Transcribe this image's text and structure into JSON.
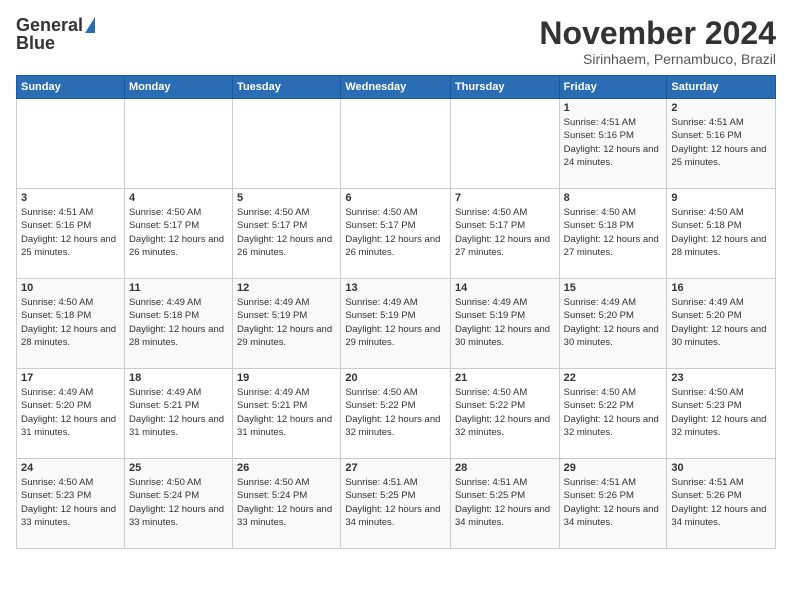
{
  "header": {
    "logo_line1": "General",
    "logo_line2": "Blue",
    "title": "November 2024",
    "subtitle": "Sirinhaem, Pernambuco, Brazil"
  },
  "calendar": {
    "days_of_week": [
      "Sunday",
      "Monday",
      "Tuesday",
      "Wednesday",
      "Thursday",
      "Friday",
      "Saturday"
    ],
    "weeks": [
      [
        {
          "day": "",
          "info": ""
        },
        {
          "day": "",
          "info": ""
        },
        {
          "day": "",
          "info": ""
        },
        {
          "day": "",
          "info": ""
        },
        {
          "day": "",
          "info": ""
        },
        {
          "day": "1",
          "info": "Sunrise: 4:51 AM\nSunset: 5:16 PM\nDaylight: 12 hours and 24 minutes."
        },
        {
          "day": "2",
          "info": "Sunrise: 4:51 AM\nSunset: 5:16 PM\nDaylight: 12 hours and 25 minutes."
        }
      ],
      [
        {
          "day": "3",
          "info": "Sunrise: 4:51 AM\nSunset: 5:16 PM\nDaylight: 12 hours and 25 minutes."
        },
        {
          "day": "4",
          "info": "Sunrise: 4:50 AM\nSunset: 5:17 PM\nDaylight: 12 hours and 26 minutes."
        },
        {
          "day": "5",
          "info": "Sunrise: 4:50 AM\nSunset: 5:17 PM\nDaylight: 12 hours and 26 minutes."
        },
        {
          "day": "6",
          "info": "Sunrise: 4:50 AM\nSunset: 5:17 PM\nDaylight: 12 hours and 26 minutes."
        },
        {
          "day": "7",
          "info": "Sunrise: 4:50 AM\nSunset: 5:17 PM\nDaylight: 12 hours and 27 minutes."
        },
        {
          "day": "8",
          "info": "Sunrise: 4:50 AM\nSunset: 5:18 PM\nDaylight: 12 hours and 27 minutes."
        },
        {
          "day": "9",
          "info": "Sunrise: 4:50 AM\nSunset: 5:18 PM\nDaylight: 12 hours and 28 minutes."
        }
      ],
      [
        {
          "day": "10",
          "info": "Sunrise: 4:50 AM\nSunset: 5:18 PM\nDaylight: 12 hours and 28 minutes."
        },
        {
          "day": "11",
          "info": "Sunrise: 4:49 AM\nSunset: 5:18 PM\nDaylight: 12 hours and 28 minutes."
        },
        {
          "day": "12",
          "info": "Sunrise: 4:49 AM\nSunset: 5:19 PM\nDaylight: 12 hours and 29 minutes."
        },
        {
          "day": "13",
          "info": "Sunrise: 4:49 AM\nSunset: 5:19 PM\nDaylight: 12 hours and 29 minutes."
        },
        {
          "day": "14",
          "info": "Sunrise: 4:49 AM\nSunset: 5:19 PM\nDaylight: 12 hours and 30 minutes."
        },
        {
          "day": "15",
          "info": "Sunrise: 4:49 AM\nSunset: 5:20 PM\nDaylight: 12 hours and 30 minutes."
        },
        {
          "day": "16",
          "info": "Sunrise: 4:49 AM\nSunset: 5:20 PM\nDaylight: 12 hours and 30 minutes."
        }
      ],
      [
        {
          "day": "17",
          "info": "Sunrise: 4:49 AM\nSunset: 5:20 PM\nDaylight: 12 hours and 31 minutes."
        },
        {
          "day": "18",
          "info": "Sunrise: 4:49 AM\nSunset: 5:21 PM\nDaylight: 12 hours and 31 minutes."
        },
        {
          "day": "19",
          "info": "Sunrise: 4:49 AM\nSunset: 5:21 PM\nDaylight: 12 hours and 31 minutes."
        },
        {
          "day": "20",
          "info": "Sunrise: 4:50 AM\nSunset: 5:22 PM\nDaylight: 12 hours and 32 minutes."
        },
        {
          "day": "21",
          "info": "Sunrise: 4:50 AM\nSunset: 5:22 PM\nDaylight: 12 hours and 32 minutes."
        },
        {
          "day": "22",
          "info": "Sunrise: 4:50 AM\nSunset: 5:22 PM\nDaylight: 12 hours and 32 minutes."
        },
        {
          "day": "23",
          "info": "Sunrise: 4:50 AM\nSunset: 5:23 PM\nDaylight: 12 hours and 32 minutes."
        }
      ],
      [
        {
          "day": "24",
          "info": "Sunrise: 4:50 AM\nSunset: 5:23 PM\nDaylight: 12 hours and 33 minutes."
        },
        {
          "day": "25",
          "info": "Sunrise: 4:50 AM\nSunset: 5:24 PM\nDaylight: 12 hours and 33 minutes."
        },
        {
          "day": "26",
          "info": "Sunrise: 4:50 AM\nSunset: 5:24 PM\nDaylight: 12 hours and 33 minutes."
        },
        {
          "day": "27",
          "info": "Sunrise: 4:51 AM\nSunset: 5:25 PM\nDaylight: 12 hours and 34 minutes."
        },
        {
          "day": "28",
          "info": "Sunrise: 4:51 AM\nSunset: 5:25 PM\nDaylight: 12 hours and 34 minutes."
        },
        {
          "day": "29",
          "info": "Sunrise: 4:51 AM\nSunset: 5:26 PM\nDaylight: 12 hours and 34 minutes."
        },
        {
          "day": "30",
          "info": "Sunrise: 4:51 AM\nSunset: 5:26 PM\nDaylight: 12 hours and 34 minutes."
        }
      ]
    ]
  }
}
